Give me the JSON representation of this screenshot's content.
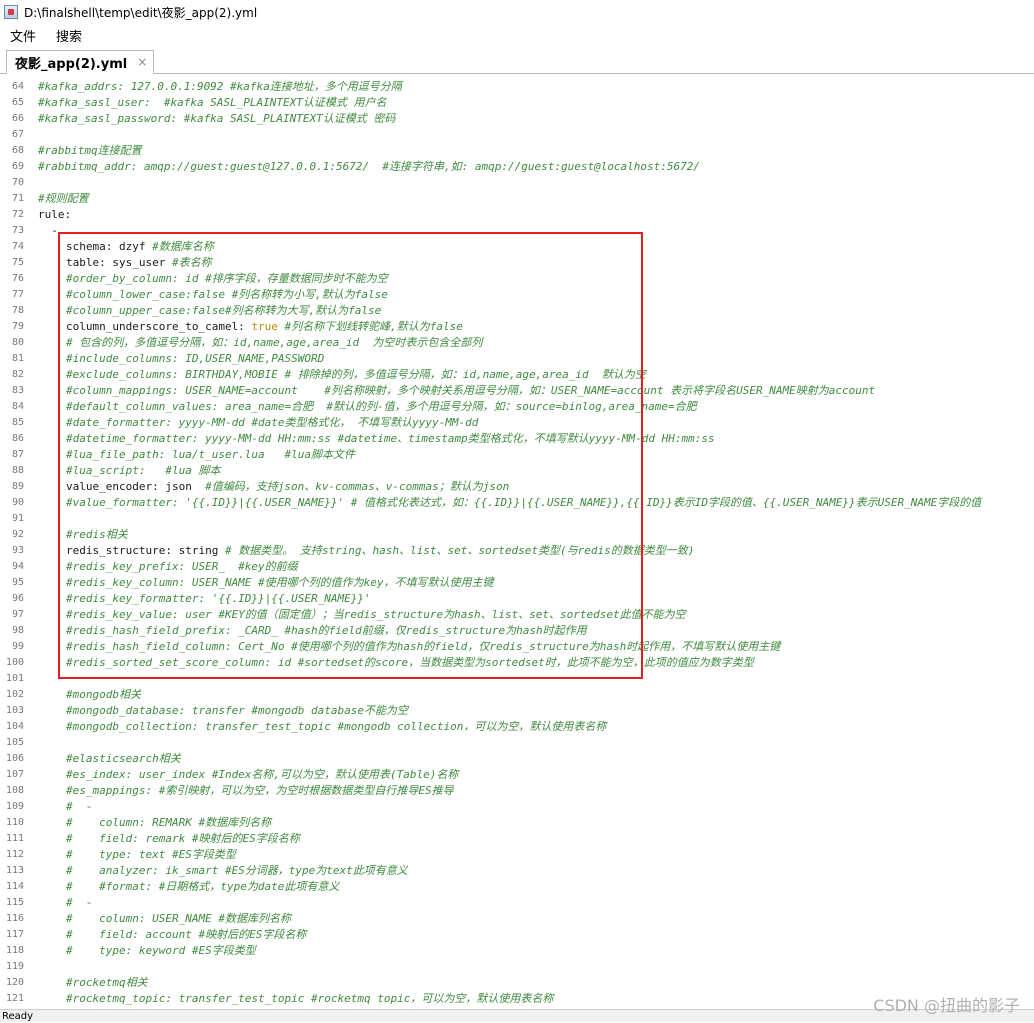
{
  "window": {
    "title": "D:\\finalshell\\temp\\edit\\夜影_app(2).yml"
  },
  "menu": {
    "items": [
      "文件",
      "搜索"
    ]
  },
  "tab": {
    "label": "夜影_app(2).yml",
    "close": "×"
  },
  "lines": [
    {
      "n": "64",
      "i": 0,
      "s": [
        {
          "c": "cm",
          "t": "#kafka_addrs: 127.0.0.1:9092 #kafka连接地址，多个用逗号分隔"
        }
      ]
    },
    {
      "n": "65",
      "i": 0,
      "s": [
        {
          "c": "cm",
          "t": "#kafka_sasl_user:  #kafka SASL_PLAINTEXT认证模式 用户名"
        }
      ]
    },
    {
      "n": "66",
      "i": 0,
      "s": [
        {
          "c": "cm",
          "t": "#kafka_sasl_password: #kafka SASL_PLAINTEXT认证模式 密码"
        }
      ]
    },
    {
      "n": "67",
      "i": 0,
      "s": []
    },
    {
      "n": "68",
      "i": 0,
      "s": [
        {
          "c": "cm",
          "t": "#rabbitmq连接配置"
        }
      ]
    },
    {
      "n": "69",
      "i": 0,
      "s": [
        {
          "c": "cm",
          "t": "#rabbitmq_addr: amqp://guest:guest@127.0.0.1:5672/  #连接字符串,如: amqp://guest:guest@localhost:5672/"
        }
      ]
    },
    {
      "n": "70",
      "i": 0,
      "s": []
    },
    {
      "n": "71",
      "i": 0,
      "s": [
        {
          "c": "cm",
          "t": "#规则配置"
        }
      ]
    },
    {
      "n": "72",
      "i": 0,
      "s": [
        {
          "c": "kw",
          "t": "rule:"
        }
      ]
    },
    {
      "n": "73",
      "i": 0,
      "s": [
        {
          "c": "kw",
          "t": "  -"
        }
      ]
    },
    {
      "n": "74",
      "i": 1,
      "s": [
        {
          "c": "kw",
          "t": "schema: dzyf "
        },
        {
          "c": "cm",
          "t": "#数据库名称"
        }
      ]
    },
    {
      "n": "75",
      "i": 1,
      "s": [
        {
          "c": "kw",
          "t": "table: sys_user "
        },
        {
          "c": "cm",
          "t": "#表名称"
        }
      ]
    },
    {
      "n": "76",
      "i": 1,
      "s": [
        {
          "c": "cm",
          "t": "#order_by_column: id #排序字段，存量数据同步时不能为空"
        }
      ]
    },
    {
      "n": "77",
      "i": 1,
      "s": [
        {
          "c": "cm",
          "t": "#column_lower_case:false #列名称转为小写,默认为false"
        }
      ]
    },
    {
      "n": "78",
      "i": 1,
      "s": [
        {
          "c": "cm",
          "t": "#column_upper_case:false#列名称转为大写,默认为false"
        }
      ]
    },
    {
      "n": "79",
      "i": 1,
      "s": [
        {
          "c": "kw",
          "t": "column_underscore_to_camel: "
        },
        {
          "c": "bool",
          "t": "true"
        },
        {
          "c": "cm",
          "t": " #列名称下划线转驼峰,默认为false"
        }
      ]
    },
    {
      "n": "80",
      "i": 1,
      "s": [
        {
          "c": "cm",
          "t": "# 包含的列，多值逗号分隔，如：id,name,age,area_id  为空时表示包含全部列"
        }
      ]
    },
    {
      "n": "81",
      "i": 1,
      "s": [
        {
          "c": "cm",
          "t": "#include_columns: ID,USER_NAME,PASSWORD"
        }
      ]
    },
    {
      "n": "82",
      "i": 1,
      "s": [
        {
          "c": "cm",
          "t": "#exclude_columns: BIRTHDAY,MOBIE # 排除掉的列，多值逗号分隔，如：id,name,age,area_id  默认为空"
        }
      ]
    },
    {
      "n": "83",
      "i": 1,
      "s": [
        {
          "c": "cm",
          "t": "#column_mappings: USER_NAME=account    #列名称映射，多个映射关系用逗号分隔，如：USER_NAME=account 表示将字段名USER_NAME映射为account"
        }
      ]
    },
    {
      "n": "84",
      "i": 1,
      "s": [
        {
          "c": "cm",
          "t": "#default_column_values: area_name=合肥  #默认的列-值，多个用逗号分隔，如：source=binlog,area_name=合肥"
        }
      ]
    },
    {
      "n": "85",
      "i": 1,
      "s": [
        {
          "c": "cm",
          "t": "#date_formatter: yyyy-MM-dd #date类型格式化， 不填写默认yyyy-MM-dd"
        }
      ]
    },
    {
      "n": "86",
      "i": 1,
      "s": [
        {
          "c": "cm",
          "t": "#datetime_formatter: yyyy-MM-dd HH:mm:ss #datetime、timestamp类型格式化，不填写默认yyyy-MM-dd HH:mm:ss"
        }
      ]
    },
    {
      "n": "87",
      "i": 1,
      "s": [
        {
          "c": "cm",
          "t": "#lua_file_path: lua/t_user.lua   #lua脚本文件"
        }
      ]
    },
    {
      "n": "88",
      "i": 1,
      "s": [
        {
          "c": "cm",
          "t": "#lua_script:   #lua 脚本"
        }
      ]
    },
    {
      "n": "89",
      "i": 1,
      "s": [
        {
          "c": "kw",
          "t": "value_encoder: json  "
        },
        {
          "c": "cm",
          "t": "#值编码，支持json、kv-commas、v-commas；默认为json"
        }
      ]
    },
    {
      "n": "90",
      "i": 1,
      "s": [
        {
          "c": "cm",
          "t": "#value_formatter: '{{.ID}}|{{.USER_NAME}}' # 值格式化表达式，如：{{.ID}}|{{.USER_NAME}},{{.ID}}表示ID字段的值、{{.USER_NAME}}表示USER_NAME字段的值"
        }
      ]
    },
    {
      "n": "91",
      "i": 0,
      "s": []
    },
    {
      "n": "92",
      "i": 1,
      "s": [
        {
          "c": "cm",
          "t": "#redis相关"
        }
      ]
    },
    {
      "n": "93",
      "i": 1,
      "s": [
        {
          "c": "kw",
          "t": "redis_structure: string "
        },
        {
          "c": "cm",
          "t": "# 数据类型。 支持string、hash、list、set、sortedset类型(与redis的数据类型一致)"
        }
      ]
    },
    {
      "n": "94",
      "i": 1,
      "s": [
        {
          "c": "cm",
          "t": "#redis_key_prefix: USER_  #key的前缀"
        }
      ]
    },
    {
      "n": "95",
      "i": 1,
      "s": [
        {
          "c": "cm",
          "t": "#redis_key_column: USER_NAME #使用哪个列的值作为key，不填写默认使用主键"
        }
      ]
    },
    {
      "n": "96",
      "i": 1,
      "s": [
        {
          "c": "cm",
          "t": "#redis_key_formatter: '{{.ID}}|{{.USER_NAME}}'"
        }
      ]
    },
    {
      "n": "97",
      "i": 1,
      "s": [
        {
          "c": "cm",
          "t": "#redis_key_value: user #KEY的值（固定值）；当redis_structure为hash、list、set、sortedset此值不能为空"
        }
      ]
    },
    {
      "n": "98",
      "i": 1,
      "s": [
        {
          "c": "cm",
          "t": "#redis_hash_field_prefix: _CARD_ #hash的field前缀，仅redis_structure为hash时起作用"
        }
      ]
    },
    {
      "n": "99",
      "i": 1,
      "s": [
        {
          "c": "cm",
          "t": "#redis_hash_field_column: Cert_No #使用哪个列的值作为hash的field，仅redis_structure为hash时起作用，不填写默认使用主键"
        }
      ]
    },
    {
      "n": "100",
      "i": 1,
      "s": [
        {
          "c": "cm",
          "t": "#redis_sorted_set_score_column: id #sortedset的score，当数据类型为sortedset时，此项不能为空，此项的值应为数字类型"
        }
      ]
    },
    {
      "n": "101",
      "i": 0,
      "s": []
    },
    {
      "n": "102",
      "i": 1,
      "s": [
        {
          "c": "cm",
          "t": "#mongodb相关"
        }
      ]
    },
    {
      "n": "103",
      "i": 1,
      "s": [
        {
          "c": "cm",
          "t": "#mongodb_database: transfer #mongodb database不能为空"
        }
      ]
    },
    {
      "n": "104",
      "i": 1,
      "s": [
        {
          "c": "cm",
          "t": "#mongodb_collection: transfer_test_topic #mongodb collection，可以为空，默认使用表名称"
        }
      ]
    },
    {
      "n": "105",
      "i": 0,
      "s": []
    },
    {
      "n": "106",
      "i": 1,
      "s": [
        {
          "c": "cm",
          "t": "#elasticsearch相关"
        }
      ]
    },
    {
      "n": "107",
      "i": 1,
      "s": [
        {
          "c": "cm",
          "t": "#es_index: user_index #Index名称,可以为空，默认使用表(Table)名称"
        }
      ]
    },
    {
      "n": "108",
      "i": 1,
      "s": [
        {
          "c": "cm",
          "t": "#es_mappings: #索引映射，可以为空，为空时根据数据类型自行推导ES推导"
        }
      ]
    },
    {
      "n": "109",
      "i": 1,
      "s": [
        {
          "c": "cm",
          "t": "#  -"
        }
      ]
    },
    {
      "n": "110",
      "i": 1,
      "s": [
        {
          "c": "cm",
          "t": "#    column: REMARK #数据库列名称"
        }
      ]
    },
    {
      "n": "111",
      "i": 1,
      "s": [
        {
          "c": "cm",
          "t": "#    field: remark #映射后的ES字段名称"
        }
      ]
    },
    {
      "n": "112",
      "i": 1,
      "s": [
        {
          "c": "cm",
          "t": "#    type: text #ES字段类型"
        }
      ]
    },
    {
      "n": "113",
      "i": 1,
      "s": [
        {
          "c": "cm",
          "t": "#    analyzer: ik_smart #ES分词器，type为text此项有意义"
        }
      ]
    },
    {
      "n": "114",
      "i": 1,
      "s": [
        {
          "c": "cm",
          "t": "#    #format: #日期格式，type为date此项有意义"
        }
      ]
    },
    {
      "n": "115",
      "i": 1,
      "s": [
        {
          "c": "cm",
          "t": "#  -"
        }
      ]
    },
    {
      "n": "116",
      "i": 1,
      "s": [
        {
          "c": "cm",
          "t": "#    column: USER_NAME #数据库列名称"
        }
      ]
    },
    {
      "n": "117",
      "i": 1,
      "s": [
        {
          "c": "cm",
          "t": "#    field: account #映射后的ES字段名称"
        }
      ]
    },
    {
      "n": "118",
      "i": 1,
      "s": [
        {
          "c": "cm",
          "t": "#    type: keyword #ES字段类型"
        }
      ]
    },
    {
      "n": "119",
      "i": 0,
      "s": []
    },
    {
      "n": "120",
      "i": 1,
      "s": [
        {
          "c": "cm",
          "t": "#rocketmq相关"
        }
      ]
    },
    {
      "n": "121",
      "i": 1,
      "s": [
        {
          "c": "cm",
          "t": "#rocketmq_topic: transfer_test_topic #rocketmq topic，可以为空，默认使用表名称"
        }
      ]
    }
  ],
  "status": {
    "text": "Ready"
  },
  "watermark": "CSDN @扭曲的影子",
  "colors": {
    "comment": "#3f8b3f",
    "boolean": "#b8860b",
    "highlight_border": "#e02020"
  }
}
